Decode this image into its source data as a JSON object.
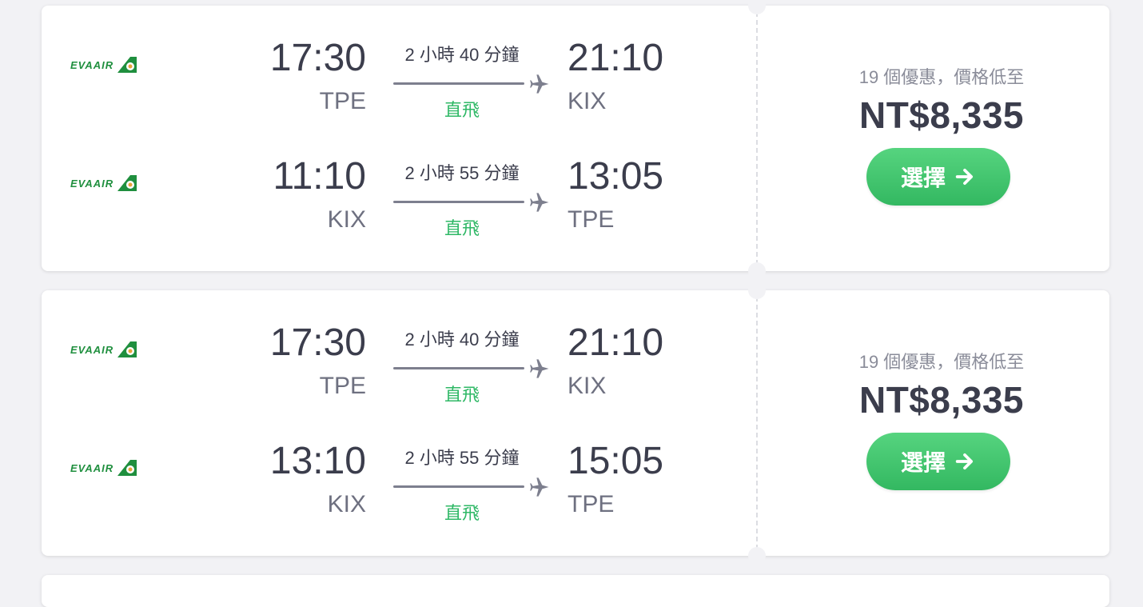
{
  "colors": {
    "background": "#f2f2f5",
    "card": "#ffffff",
    "nonstop_green": "#2fb866",
    "button_green": "#3cc36b",
    "text_dark": "#3b3d4c",
    "text_muted": "#8a8c99",
    "logo_green": "#1f8f3e"
  },
  "icons": {
    "plane": "airplane-icon",
    "arrow": "arrow-right-icon",
    "logo": "eva-air-logo"
  },
  "cards": [
    {
      "legs": [
        {
          "airline_logo_text": "EVAAIR",
          "dep_time": "17:30",
          "dep_code": "TPE",
          "duration": "2 小時 40 分鐘",
          "stops": "直飛",
          "arr_time": "21:10",
          "arr_code": "KIX"
        },
        {
          "airline_logo_text": "EVAAIR",
          "dep_time": "11:10",
          "dep_code": "KIX",
          "duration": "2 小時 55 分鐘",
          "stops": "直飛",
          "arr_time": "13:05",
          "arr_code": "TPE"
        }
      ],
      "deals_text": "19 個優惠，價格低至",
      "price": "NT$8,335",
      "select_label": "選擇"
    },
    {
      "legs": [
        {
          "airline_logo_text": "EVAAIR",
          "dep_time": "17:30",
          "dep_code": "TPE",
          "duration": "2 小時 40 分鐘",
          "stops": "直飛",
          "arr_time": "21:10",
          "arr_code": "KIX"
        },
        {
          "airline_logo_text": "EVAAIR",
          "dep_time": "13:10",
          "dep_code": "KIX",
          "duration": "2 小時 55 分鐘",
          "stops": "直飛",
          "arr_time": "15:05",
          "arr_code": "TPE"
        }
      ],
      "deals_text": "19 個優惠，價格低至",
      "price": "NT$8,335",
      "select_label": "選擇"
    }
  ]
}
